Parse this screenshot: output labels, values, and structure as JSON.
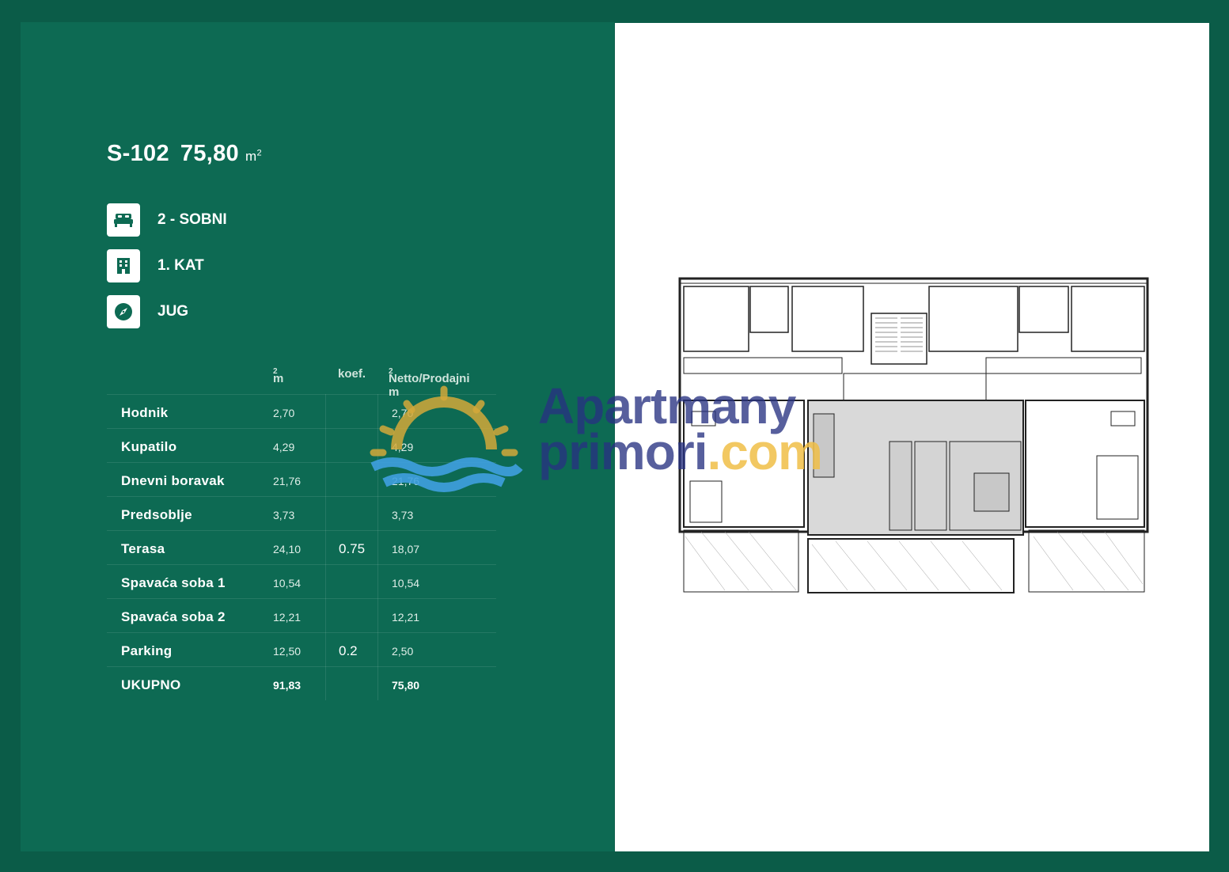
{
  "unit": {
    "code": "S-102",
    "area": "75,80",
    "area_unit": "m",
    "area_unit_sup": "2"
  },
  "features": [
    {
      "icon": "bed-icon",
      "label": "2 - SOBNI"
    },
    {
      "icon": "building-icon",
      "label": "1. KAT"
    },
    {
      "icon": "compass-icon",
      "label": "JUG"
    }
  ],
  "table": {
    "headers": {
      "m2": "m",
      "m2_sup": "2",
      "koef": "koef.",
      "netto": "Netto/Prodajni m",
      "netto_sup": "2"
    },
    "rows": [
      {
        "name": "Hodnik",
        "m2": "2,70",
        "koef": "",
        "netto": "2,70"
      },
      {
        "name": "Kupatilo",
        "m2": "4,29",
        "koef": "",
        "netto": "4,29"
      },
      {
        "name": "Dnevni boravak",
        "m2": "21,76",
        "koef": "",
        "netto": "21,76"
      },
      {
        "name": "Predsoblje",
        "m2": "3,73",
        "koef": "",
        "netto": "3,73"
      },
      {
        "name": "Terasa",
        "m2": "24,10",
        "koef": "0.75",
        "netto": "18,07"
      },
      {
        "name": "Spavaća soba 1",
        "m2": "10,54",
        "koef": "",
        "netto": "10,54"
      },
      {
        "name": "Spavaća soba 2",
        "m2": "12,21",
        "koef": "",
        "netto": "12,21"
      },
      {
        "name": "Parking",
        "m2": "12,50",
        "koef": "0.2",
        "netto": "2,50"
      }
    ],
    "total": {
      "name": "UKUPNO",
      "m2": "91,83",
      "koef": "",
      "netto": "75,80"
    }
  },
  "watermark": {
    "line1": "Apartmany",
    "line2a": "primori",
    "line2b": ".com"
  },
  "colors": {
    "background": "#0b5c48",
    "panel": "#0d6a53",
    "accent_sun": "#d4a83a",
    "accent_wave": "#3fa0e0",
    "watermark_text": "#283282"
  }
}
